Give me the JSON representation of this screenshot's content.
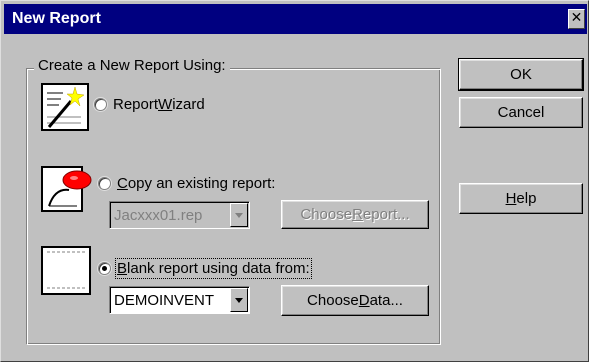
{
  "window": {
    "title": "New Report",
    "close_glyph": "✕"
  },
  "group": {
    "label": "Create a New Report Using:"
  },
  "options": {
    "wizard": {
      "pre": "Report",
      "accel": "W",
      "post": "izard",
      "selected": false
    },
    "copy": {
      "pre": "",
      "accel": "C",
      "post": "opy an existing report:",
      "selected": false
    },
    "blank": {
      "pre": "",
      "accel": "B",
      "post": "lank report using data from:",
      "selected": true
    }
  },
  "copy_combo": {
    "value": "Jacxxx01.rep",
    "disabled": true
  },
  "blank_combo": {
    "value": "DEMOINVENT",
    "disabled": false
  },
  "buttons": {
    "ok": "OK",
    "cancel": "Cancel",
    "help": {
      "pre": "",
      "accel": "H",
      "post": "elp"
    },
    "choose_report": {
      "pre": "Choose ",
      "accel": "R",
      "post": "eport..."
    },
    "choose_data": {
      "pre": "Choose ",
      "accel": "D",
      "post": "ata..."
    }
  },
  "icons": {
    "wizard": "report-wizard-icon",
    "copy": "copy-report-icon",
    "blank": "blank-report-icon"
  },
  "colors": {
    "titlebar": "#000080",
    "face": "#c0c0c0",
    "disabled_text": "#808080"
  }
}
